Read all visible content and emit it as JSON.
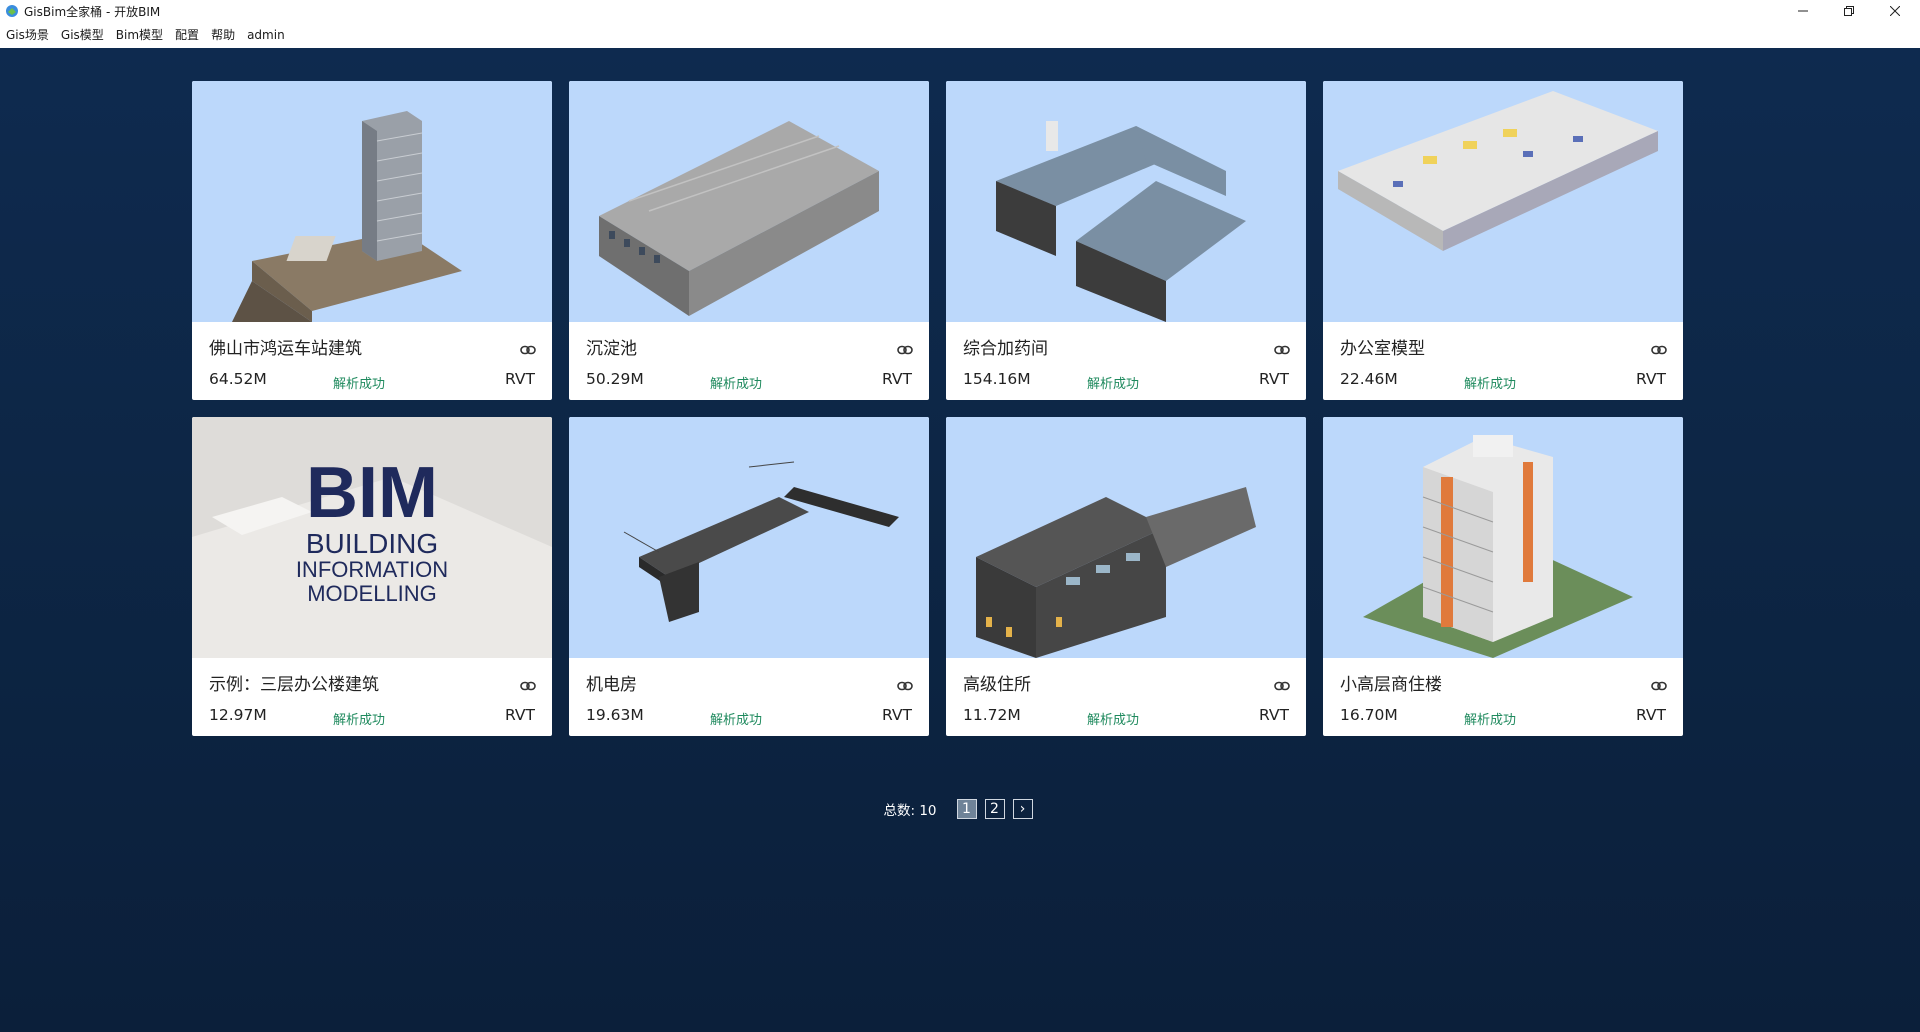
{
  "window": {
    "title": "GisBim全家桶 - 开放BIM",
    "icons": [
      "app-icon",
      "minimize-icon",
      "restore-icon",
      "close-icon"
    ]
  },
  "menu": [
    "Gis场景",
    "Gis模型",
    "Bim模型",
    "配置",
    "帮助",
    "admin"
  ],
  "cards": [
    {
      "title": "佛山市鸿运车站建筑",
      "size": "64.52M",
      "status": "解析成功",
      "type": "RVT"
    },
    {
      "title": "沉淀池",
      "size": "50.29M",
      "status": "解析成功",
      "type": "RVT"
    },
    {
      "title": "综合加药间",
      "size": "154.16M",
      "status": "解析成功",
      "type": "RVT"
    },
    {
      "title": "办公室模型",
      "size": "22.46M",
      "status": "解析成功",
      "type": "RVT"
    },
    {
      "title": "示例：三层办公楼建筑",
      "size": "12.97M",
      "status": "解析成功",
      "type": "RVT"
    },
    {
      "title": "机电房",
      "size": "19.63M",
      "status": "解析成功",
      "type": "RVT"
    },
    {
      "title": "高级住所",
      "size": "11.72M",
      "status": "解析成功",
      "type": "RVT"
    },
    {
      "title": "小高层商住楼",
      "size": "16.70M",
      "status": "解析成功",
      "type": "RVT"
    }
  ],
  "bim_logo": {
    "big": "BIM",
    "line1": "BUILDING",
    "line2": "INFORMATION",
    "line3": "MODELLING"
  },
  "pagination": {
    "total_label": "总数: 10",
    "pages": [
      "1",
      "2"
    ],
    "next": "›",
    "current": "1"
  },
  "colors": {
    "thumb_bg": "#bcd8fb",
    "status": "#1f8a5e",
    "page_bg": "#0f2a4e"
  }
}
